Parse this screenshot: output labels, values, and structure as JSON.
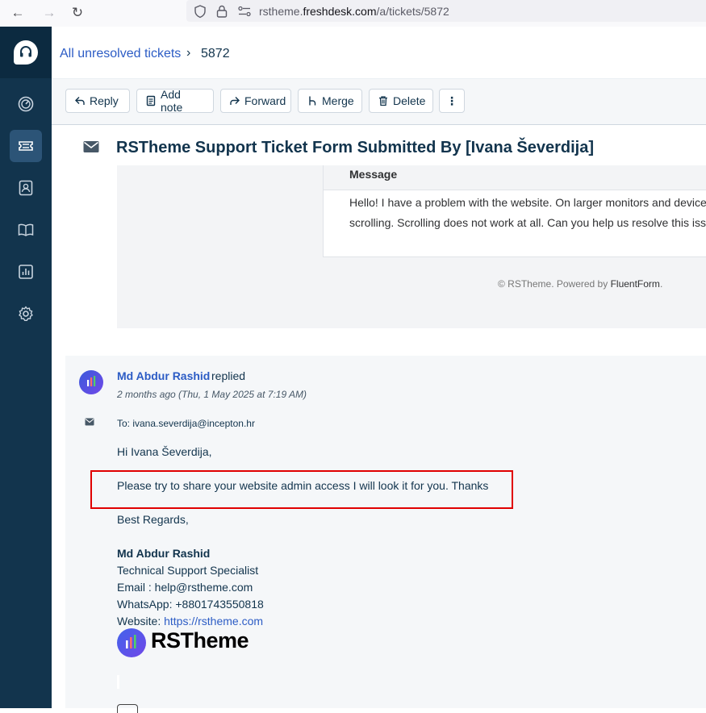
{
  "browser": {
    "url_prefix": "rstheme.",
    "url_domain": "freshdesk.com",
    "url_path": "/a/tickets/5872"
  },
  "breadcrumb": {
    "parent": "All unresolved tickets",
    "separator": "›",
    "current": "5872"
  },
  "toolbar": {
    "reply": "Reply",
    "add_note": "Add note",
    "forward": "Forward",
    "merge": "Merge",
    "delete": "Delete",
    "more": "⋮"
  },
  "ticket": {
    "subject": "RSTheme Support Ticket Form Submitted By [Ivana Ševerdija]",
    "form": {
      "message_label": "Message",
      "message_line1": "Hello! I have a problem with the website. On larger monitors and device",
      "message_line2": "scrolling. Scrolling does not work at all. Can you help us resolve this issu",
      "footer_prefix": "© RSTheme. Powered by ",
      "footer_brand": "FluentForm",
      "footer_suffix": "."
    }
  },
  "reply": {
    "author": "Md Abdur Rashid",
    "action": "replied",
    "timestamp": "2 months ago (Thu, 1 May 2025 at 7:19 AM)",
    "to_line": "To: ivana.severdija@incepton.hr",
    "greeting": "Hi Ivana Ševerdija,",
    "body": "Please try to share your website admin access I will look it for you. Thanks",
    "closing": "Best Regards,",
    "sig_name": "Md Abdur Rashid",
    "sig_title": "Technical Support Specialist",
    "sig_email": "Email : help@rstheme.com",
    "sig_whatsapp": "WhatsApp: +8801743550818",
    "sig_website_label": "Website: ",
    "sig_website_url": "https://rstheme.com",
    "logo_text": "RSTheme"
  },
  "colors": {
    "sidebar": "#12344d",
    "link": "#2c5cc5",
    "highlight_border": "#e00000"
  }
}
